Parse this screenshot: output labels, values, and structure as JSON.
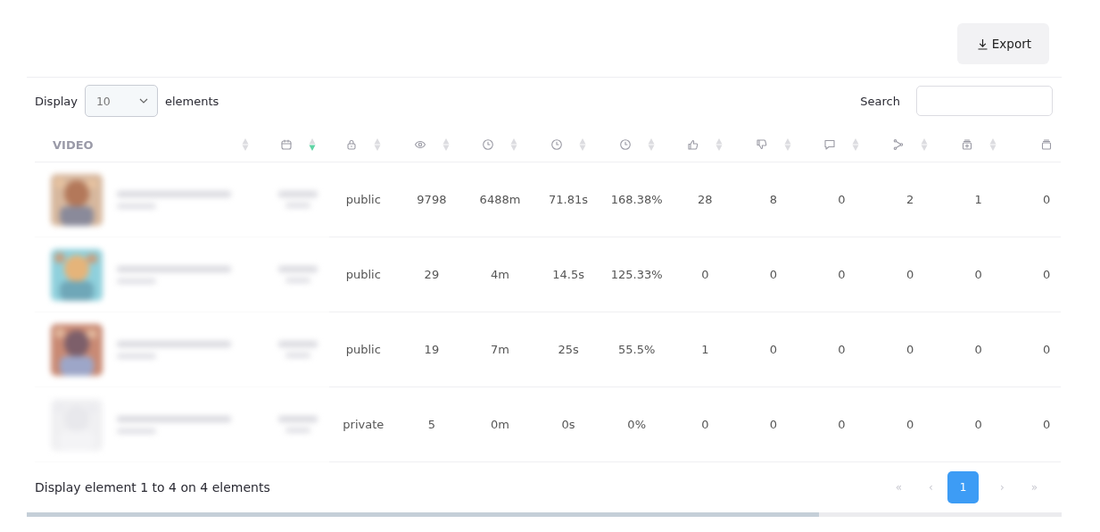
{
  "toolbar": {
    "export_button": "Export"
  },
  "length_control": {
    "prefix": "Display",
    "value": "10",
    "suffix": "elements"
  },
  "search": {
    "label": "Search"
  },
  "table": {
    "columns": [
      {
        "label": "VIDEO",
        "sortable": true,
        "sorted": false
      },
      {
        "sortable": true,
        "sorted": true
      },
      {
        "sortable": true,
        "sorted": false
      },
      {
        "sortable": true,
        "sorted": false
      },
      {
        "sortable": true,
        "sorted": false
      },
      {
        "sortable": true,
        "sorted": false
      },
      {
        "sortable": true,
        "sorted": false
      },
      {
        "sortable": true,
        "sorted": false
      },
      {
        "sortable": true,
        "sorted": false
      },
      {
        "sortable": true,
        "sorted": false
      },
      {
        "sortable": true,
        "sorted": false
      },
      {
        "sortable": true,
        "sorted": false
      },
      {
        "sortable": false
      }
    ],
    "rows": [
      {
        "cells": [
          "public",
          "9798",
          "6488m",
          "71.81s",
          "168.38%",
          "28",
          "8",
          "0",
          "2",
          "1",
          "0"
        ]
      },
      {
        "cells": [
          "public",
          "29",
          "4m",
          "14.5s",
          "125.33%",
          "0",
          "0",
          "0",
          "0",
          "0",
          "0"
        ]
      },
      {
        "cells": [
          "public",
          "19",
          "7m",
          "25s",
          "55.5%",
          "1",
          "0",
          "0",
          "0",
          "0",
          "0"
        ]
      },
      {
        "cells": [
          "private",
          "5",
          "0m",
          "0s",
          "0%",
          "0",
          "0",
          "0",
          "0",
          "0",
          "0"
        ]
      }
    ]
  },
  "footer": {
    "info": "Display element 1 to 4 on 4 elements"
  },
  "pagination": [
    {
      "label": "«",
      "selected": false,
      "disabled": true
    },
    {
      "label": "‹",
      "selected": false,
      "disabled": true
    },
    {
      "label": "1",
      "selected": true,
      "disabled": false
    },
    {
      "label": "›",
      "selected": false,
      "disabled": true
    },
    {
      "label": "»",
      "selected": false,
      "disabled": true
    }
  ]
}
